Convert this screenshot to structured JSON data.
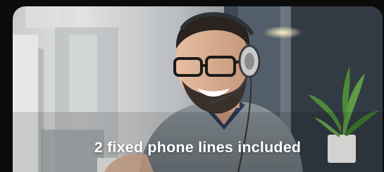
{
  "hero": {
    "caption": "2 fixed phone lines included"
  },
  "icons": [
    "headset-icon",
    "plant-icon"
  ]
}
